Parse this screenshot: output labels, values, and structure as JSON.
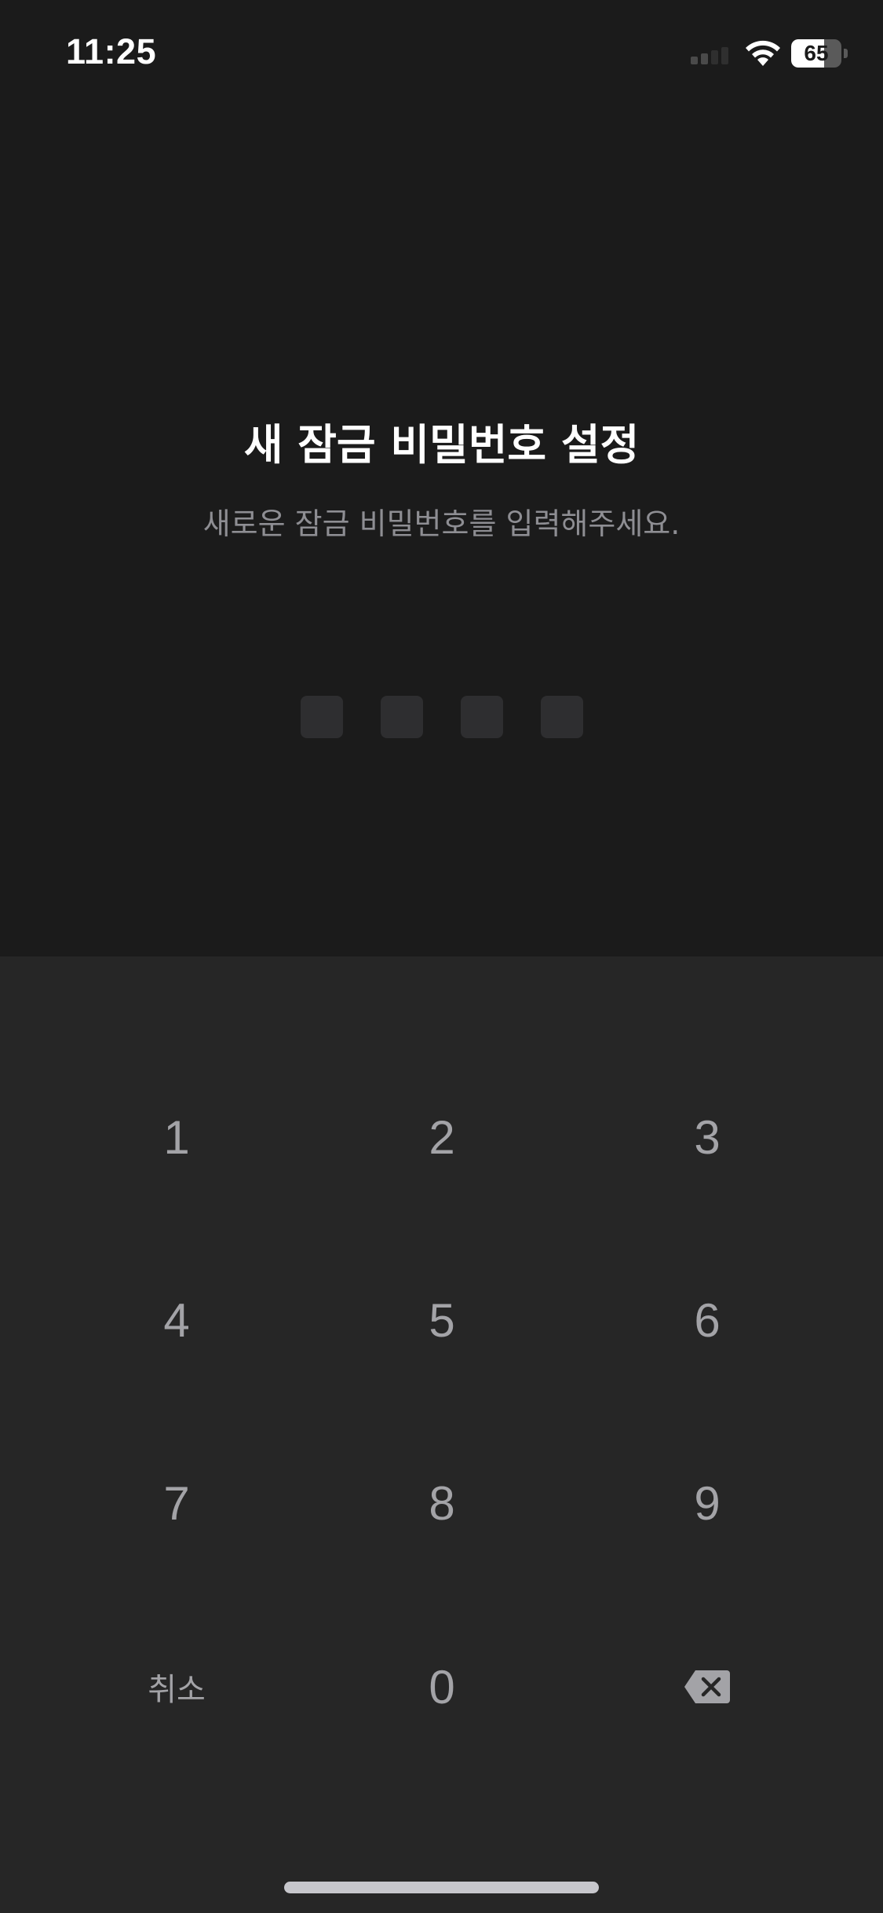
{
  "status_bar": {
    "time": "11:25",
    "battery_level": "65",
    "battery_fraction": 0.65
  },
  "header": {
    "title": "새 잠금 비밀번호 설정",
    "subtitle": "새로운 잠금 비밀번호를 입력해주세요."
  },
  "pin": {
    "length": 4,
    "entered": 0
  },
  "keypad": {
    "keys": [
      "1",
      "2",
      "3",
      "4",
      "5",
      "6",
      "7",
      "8",
      "9"
    ],
    "cancel_label": "취소",
    "zero_label": "0",
    "backspace_icon": "backspace-icon"
  },
  "colors": {
    "background_top": "#1b1b1b",
    "keypad_background": "#262626",
    "key_text": "#a3a3a7",
    "subtitle_text": "#8e8e93",
    "pin_box": "#2e2e30"
  }
}
